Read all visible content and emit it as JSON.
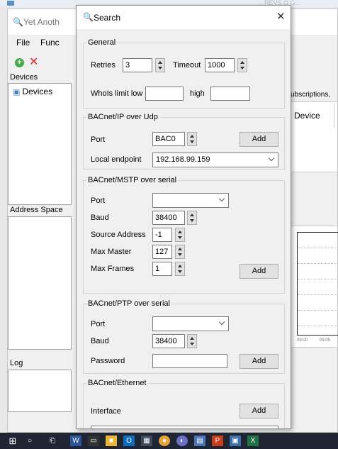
{
  "background_window": {
    "title": "Yet Anoth",
    "faded_caption": "... REVS.O G...",
    "menu": [
      "File",
      "Func"
    ],
    "devices_pane_title": "Devices",
    "devices_tree_item": "Devices",
    "address_space_title": "Address Space",
    "log_title": "Log",
    "subscriptions_header": "ubscriptions,",
    "grid_column": "Device",
    "chart_x_ticks": [
      "09:00",
      "09:05"
    ]
  },
  "dialog": {
    "title": "Search",
    "general": {
      "legend": "General",
      "retries_label": "Retries",
      "retries_value": "3",
      "timeout_label": "Timeout",
      "timeout_value": "1000",
      "whois_label": "WhoIs limit low",
      "whois_low_value": "",
      "high_label": "high",
      "whois_high_value": ""
    },
    "ip": {
      "legend": "BACnet/IP over Udp",
      "port_label": "Port",
      "port_value": "BAC0",
      "add_label": "Add",
      "endpoint_label": "Local endpoint",
      "endpoint_value": "192.168.99.159"
    },
    "mstp": {
      "legend": "BACnet/MSTP over serial",
      "port_label": "Port",
      "port_value": "",
      "baud_label": "Baud",
      "baud_value": "38400",
      "source_label": "Source Address",
      "source_value": "-1",
      "maxmaster_label": "Max Master",
      "maxmaster_value": "127",
      "maxframes_label": "Max Frames",
      "maxframes_value": "1",
      "add_label": "Add"
    },
    "ptp": {
      "legend": "BACnet/PTP over serial",
      "port_label": "Port",
      "port_value": "",
      "baud_label": "Baud",
      "baud_value": "38400",
      "password_label": "Password",
      "password_value": "",
      "add_label": "Add"
    },
    "ethernet": {
      "legend": "BACnet/Ethernet",
      "interface_label": "Interface",
      "interface_value": "",
      "add_label": "Add"
    }
  },
  "taskbar": {
    "icons": [
      "windows-start-icon",
      "search-icon",
      "task-view-icon",
      "word-icon",
      "terminal-icon",
      "file-explorer-icon",
      "outlook-icon",
      "calculator-icon",
      "chrome-icon",
      "edge-icon",
      "app-icon",
      "powerpoint-icon",
      "network-icon",
      "excel-icon"
    ]
  }
}
